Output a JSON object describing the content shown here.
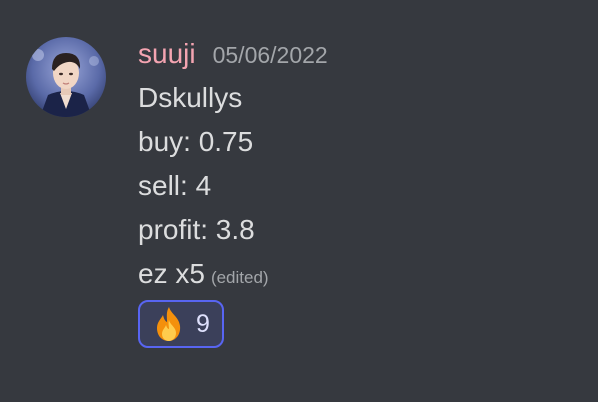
{
  "message": {
    "username": "suuji",
    "timestamp": "05/06/2022",
    "lines": [
      "Dskullys",
      "buy: 0.75",
      "sell: 4",
      "profit: 3.8",
      "ez x5"
    ],
    "edited_label": "(edited)"
  },
  "reaction": {
    "emoji": "fire-icon",
    "count": "9"
  },
  "colors": {
    "background": "#36393f",
    "username": "#f4a4b1",
    "text": "#dcddde",
    "muted": "#a3a6aa",
    "reaction_border": "#5865f2"
  }
}
